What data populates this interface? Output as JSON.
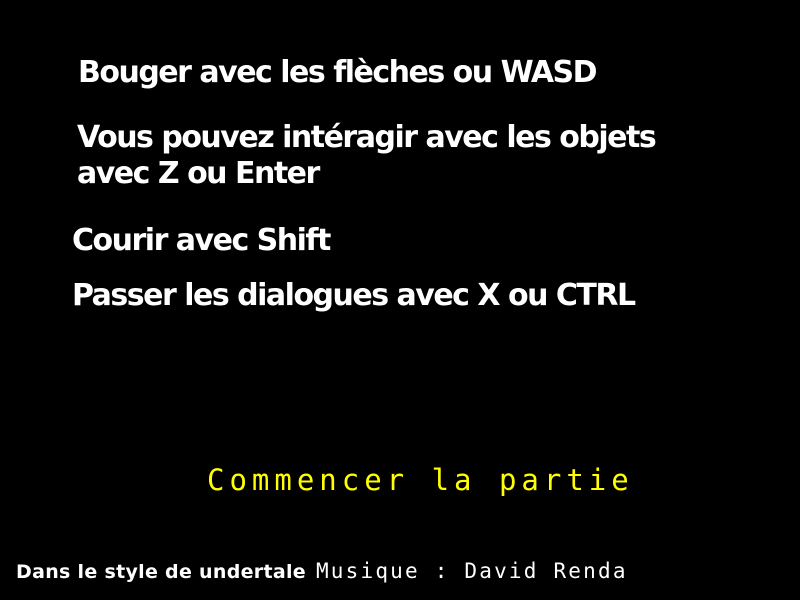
{
  "colors": {
    "background": "#000000",
    "text": "#ffffff",
    "menu_selected": "#ffff00"
  },
  "instructions": {
    "move": "Bouger avec les flèches ou WASD",
    "interact_line1": "Vous pouvez intéragir avec les objets",
    "interact_line2": "avec Z ou Enter",
    "run": "Courir avec Shift",
    "skip": "Passer les dialogues avec X ou CTRL"
  },
  "menu": {
    "start_label": "Commencer la partie"
  },
  "footer": {
    "style_credit": "Dans le style de undertale",
    "music_credit": "Musique : David Renda"
  }
}
